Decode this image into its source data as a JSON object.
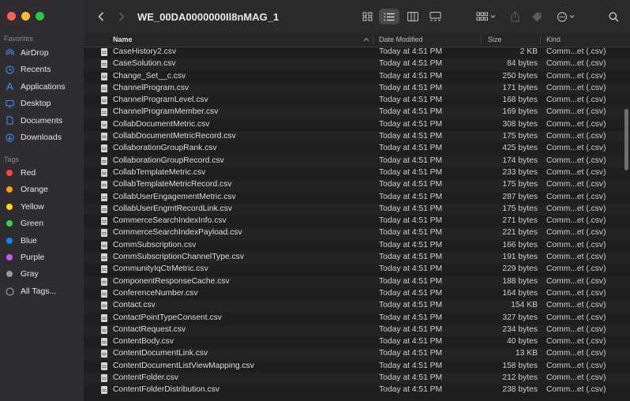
{
  "window": {
    "title": "WE_00DA0000000Il8nMAG_1"
  },
  "sidebar": {
    "favorites_title": "Favorites",
    "favorites": [
      {
        "label": "AirDrop",
        "icon": "airdrop-icon"
      },
      {
        "label": "Recents",
        "icon": "clock-icon"
      },
      {
        "label": "Applications",
        "icon": "applications-icon"
      },
      {
        "label": "Desktop",
        "icon": "desktop-icon"
      },
      {
        "label": "Documents",
        "icon": "document-icon"
      },
      {
        "label": "Downloads",
        "icon": "download-icon"
      }
    ],
    "tags_title": "Tags",
    "tags": [
      {
        "label": "Red",
        "color": "#ff453a"
      },
      {
        "label": "Orange",
        "color": "#ff9f0a"
      },
      {
        "label": "Yellow",
        "color": "#ffd60a"
      },
      {
        "label": "Green",
        "color": "#32d74b"
      },
      {
        "label": "Blue",
        "color": "#0a84ff"
      },
      {
        "label": "Purple",
        "color": "#bf5af2"
      },
      {
        "label": "Gray",
        "color": "#98989d"
      }
    ],
    "all_tags": "All Tags..."
  },
  "columns": {
    "name": "Name",
    "date": "Date Modified",
    "size": "Size",
    "kind": "Kind"
  },
  "files": [
    {
      "name": "CaseHistory2.csv",
      "date": "Today at 4:51 PM",
      "size": "2 KB",
      "kind": "Comm...et (.csv)"
    },
    {
      "name": "CaseSolution.csv",
      "date": "Today at 4:51 PM",
      "size": "84 bytes",
      "kind": "Comm...et (.csv)"
    },
    {
      "name": "Change_Set__c.csv",
      "date": "Today at 4:51 PM",
      "size": "250 bytes",
      "kind": "Comm...et (.csv)"
    },
    {
      "name": "ChannelProgram.csv",
      "date": "Today at 4:51 PM",
      "size": "171 bytes",
      "kind": "Comm...et (.csv)"
    },
    {
      "name": "ChannelProgramLevel.csv",
      "date": "Today at 4:51 PM",
      "size": "168 bytes",
      "kind": "Comm...et (.csv)"
    },
    {
      "name": "ChannelProgramMember.csv",
      "date": "Today at 4:51 PM",
      "size": "169 bytes",
      "kind": "Comm...et (.csv)"
    },
    {
      "name": "CollabDocumentMetric.csv",
      "date": "Today at 4:51 PM",
      "size": "308 bytes",
      "kind": "Comm...et (.csv)"
    },
    {
      "name": "CollabDocumentMetricRecord.csv",
      "date": "Today at 4:51 PM",
      "size": "175 bytes",
      "kind": "Comm...et (.csv)"
    },
    {
      "name": "CollaborationGroupRank.csv",
      "date": "Today at 4:51 PM",
      "size": "425 bytes",
      "kind": "Comm...et (.csv)"
    },
    {
      "name": "CollaborationGroupRecord.csv",
      "date": "Today at 4:51 PM",
      "size": "174 bytes",
      "kind": "Comm...et (.csv)"
    },
    {
      "name": "CollabTemplateMetric.csv",
      "date": "Today at 4:51 PM",
      "size": "233 bytes",
      "kind": "Comm...et (.csv)"
    },
    {
      "name": "CollabTemplateMetricRecord.csv",
      "date": "Today at 4:51 PM",
      "size": "175 bytes",
      "kind": "Comm...et (.csv)"
    },
    {
      "name": "CollabUserEngagementMetric.csv",
      "date": "Today at 4:51 PM",
      "size": "287 bytes",
      "kind": "Comm...et (.csv)"
    },
    {
      "name": "CollabUserEngmtRecordLink.csv",
      "date": "Today at 4:51 PM",
      "size": "175 bytes",
      "kind": "Comm...et (.csv)"
    },
    {
      "name": "CommerceSearchIndexInfo.csv",
      "date": "Today at 4:51 PM",
      "size": "271 bytes",
      "kind": "Comm...et (.csv)"
    },
    {
      "name": "CommerceSearchIndexPayload.csv",
      "date": "Today at 4:51 PM",
      "size": "221 bytes",
      "kind": "Comm...et (.csv)"
    },
    {
      "name": "CommSubscription.csv",
      "date": "Today at 4:51 PM",
      "size": "166 bytes",
      "kind": "Comm...et (.csv)"
    },
    {
      "name": "CommSubscriptionChannelType.csv",
      "date": "Today at 4:51 PM",
      "size": "191 bytes",
      "kind": "Comm...et (.csv)"
    },
    {
      "name": "CommunityIqCtrMetric.csv",
      "date": "Today at 4:51 PM",
      "size": "229 bytes",
      "kind": "Comm...et (.csv)"
    },
    {
      "name": "ComponentResponseCache.csv",
      "date": "Today at 4:51 PM",
      "size": "188 bytes",
      "kind": "Comm...et (.csv)"
    },
    {
      "name": "ConferenceNumber.csv",
      "date": "Today at 4:51 PM",
      "size": "164 bytes",
      "kind": "Comm...et (.csv)"
    },
    {
      "name": "Contact.csv",
      "date": "Today at 4:51 PM",
      "size": "154 KB",
      "kind": "Comm...et (.csv)"
    },
    {
      "name": "ContactPointTypeConsent.csv",
      "date": "Today at 4:51 PM",
      "size": "327 bytes",
      "kind": "Comm...et (.csv)"
    },
    {
      "name": "ContactRequest.csv",
      "date": "Today at 4:51 PM",
      "size": "234 bytes",
      "kind": "Comm...et (.csv)"
    },
    {
      "name": "ContentBody.csv",
      "date": "Today at 4:51 PM",
      "size": "40 bytes",
      "kind": "Comm...et (.csv)"
    },
    {
      "name": "ContentDocumentLink.csv",
      "date": "Today at 4:51 PM",
      "size": "13 KB",
      "kind": "Comm...et (.csv)"
    },
    {
      "name": "ContentDocumentListViewMapping.csv",
      "date": "Today at 4:51 PM",
      "size": "158 bytes",
      "kind": "Comm...et (.csv)"
    },
    {
      "name": "ContentFolder.csv",
      "date": "Today at 4:51 PM",
      "size": "212 bytes",
      "kind": "Comm...et (.csv)"
    },
    {
      "name": "ContentFolderDistribution.csv",
      "date": "Today at 4:51 PM",
      "size": "238 bytes",
      "kind": "Comm...et (.csv)"
    }
  ]
}
